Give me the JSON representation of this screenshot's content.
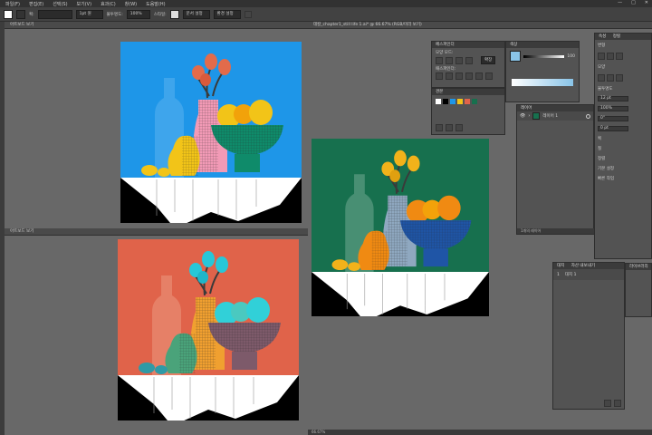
{
  "menu": {
    "items": [
      "파일(F)",
      "편집(E)",
      "선택(S)",
      "보기(V)",
      "효과(C)",
      "창(W)",
      "도움말(H)"
    ],
    "window_controls": [
      "—",
      "□",
      "✕"
    ]
  },
  "control_bar": {
    "stroke_label": "획:",
    "stroke_value": "1pt 원",
    "opacity_label": "불투명도:",
    "opacity_value": "100%",
    "style_label": "스타일:",
    "align_button": "문서 설정",
    "prefs_button": "환경 설정"
  },
  "documents": {
    "top_left_tab": "아트보드 보기",
    "bottom_left_tab": "아트보드 보기",
    "right_tab": "데칼_chapter1_still life 1.ai* @ 66.67% (RGB/미리 보기)",
    "right_status": "66.67%"
  },
  "panels": {
    "transparency_tab": "페스파인더",
    "shape_modes_label": "모양 모드:",
    "expand_button": "확장",
    "pathfinder_label": "패스파인더:",
    "swatches_tab": "견본",
    "color_tab": "색상",
    "color_value": "100",
    "layers_tab": "레이어",
    "layer_name": "레이어 1",
    "layers_count": "1개의 레이어",
    "libraries_tab": "라이브러리",
    "right_tabs": [
      "속성",
      "정렬"
    ],
    "props_labels": [
      "변형",
      "모양",
      "불투명도",
      "획",
      "칠",
      "정렬"
    ],
    "props_values": [
      "12 pt",
      "100%",
      "0°",
      "0 pt"
    ],
    "artboards_tabs": [
      "대지",
      "자산 내보내기"
    ],
    "artboard_row_num": "1",
    "artboard_row_name": "대지 1",
    "misc_labels": [
      "기본 설정",
      "빠른 작업"
    ]
  },
  "colors": {
    "blue_bg": "#1e96e8",
    "orange_bg": "#e0634a",
    "green_bg": "#17704e"
  }
}
